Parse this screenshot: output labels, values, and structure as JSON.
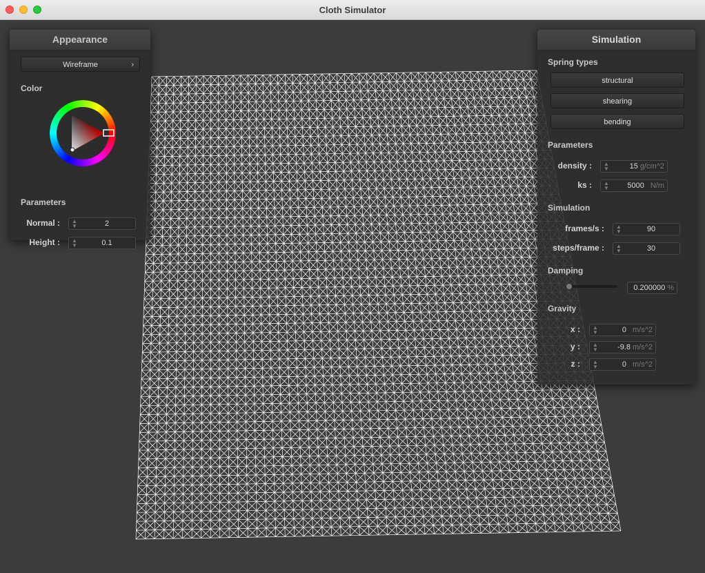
{
  "window": {
    "title": "Cloth Simulator"
  },
  "cloth": {
    "color": "#ffffff",
    "rows": 52,
    "cols": 52
  },
  "appearance": {
    "title": "Appearance",
    "shader_button": "Wireframe",
    "color_label": "Color",
    "color_value": "#ffffff",
    "parameters_label": "Parameters",
    "normal": {
      "label": "Normal :",
      "value": "2"
    },
    "height": {
      "label": "Height :",
      "value": "0.1"
    }
  },
  "simulation": {
    "title": "Simulation",
    "spring_types_label": "Spring types",
    "springs": [
      "structural",
      "shearing",
      "bending"
    ],
    "parameters_label": "Parameters",
    "density": {
      "label": "density :",
      "value": "15",
      "unit": "g/cm^2"
    },
    "ks": {
      "label": "ks :",
      "value": "5000",
      "unit": "N/m"
    },
    "simulation_label": "Simulation",
    "fps": {
      "label": "frames/s :",
      "value": "90"
    },
    "steps": {
      "label": "steps/frame :",
      "value": "30"
    },
    "damping_label": "Damping",
    "damping": {
      "value": "0.200000",
      "unit": "%",
      "fraction": 0.2
    },
    "gravity_label": "Gravity",
    "gravity": {
      "x": {
        "label": "x :",
        "value": "0",
        "unit": "m/s^2"
      },
      "y": {
        "label": "y :",
        "value": "-9.8",
        "unit": "m/s^2"
      },
      "z": {
        "label": "z :",
        "value": "0",
        "unit": "m/s^2"
      }
    }
  }
}
